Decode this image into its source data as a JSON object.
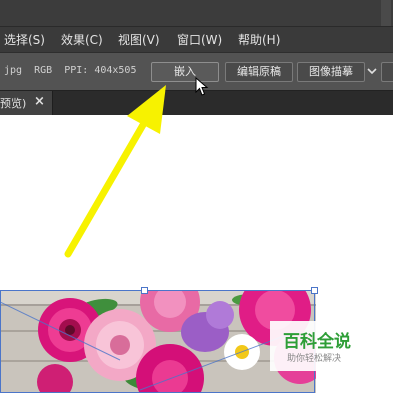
{
  "menu": {
    "items": [
      "选择(S)",
      "效果(C)",
      "视图(V)",
      "窗口(W)",
      "帮助(H)"
    ]
  },
  "options_bar": {
    "file_name": "jpg",
    "color_mode": "RGB",
    "ppi": "PPI: 404x505",
    "embed_button": "嵌入",
    "edit_original_button": "编辑原稿",
    "image_trace_button": "图像描摹"
  },
  "tab": {
    "label": "预览)",
    "close": "×"
  },
  "watermark": {
    "title": "百科全说",
    "subtitle": "助你轻松解决",
    "color": "#2e9e37"
  },
  "colors": {
    "annotation_arrow": "#f7f200",
    "selection": "#4b75c9"
  }
}
